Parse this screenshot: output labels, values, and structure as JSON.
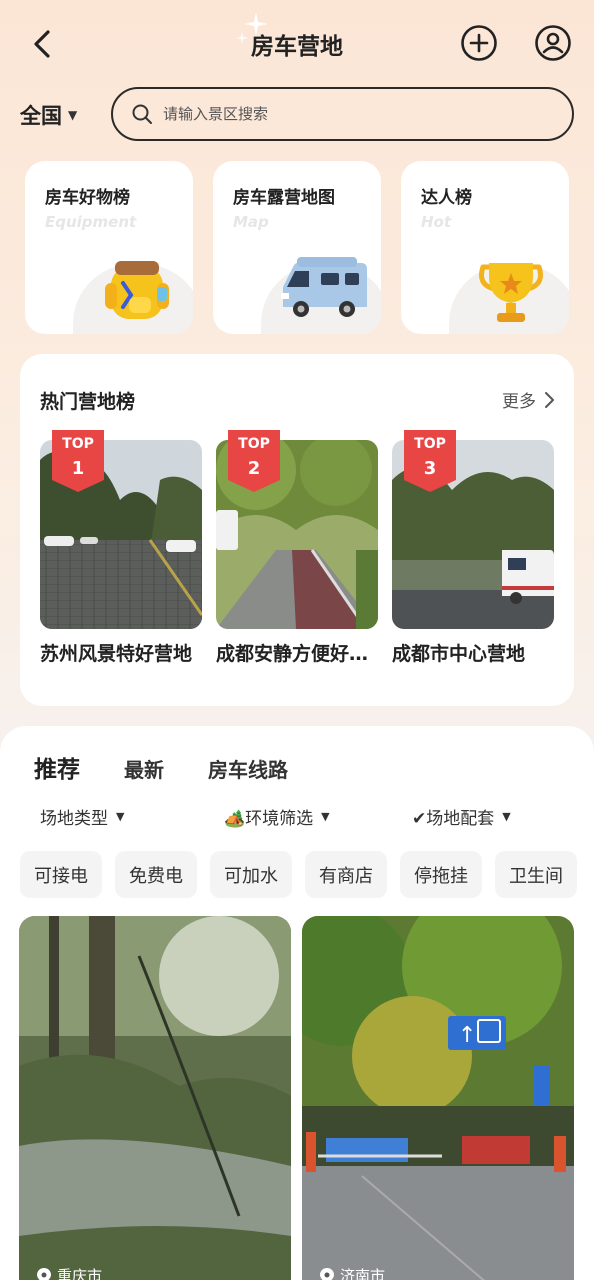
{
  "header": {
    "title": "房车营地",
    "back_icon": "chevron-left-icon",
    "add_icon": "plus-circle-icon",
    "user_icon": "user-circle-icon"
  },
  "location": {
    "value": "全国"
  },
  "search": {
    "placeholder": "请输入景区搜索"
  },
  "categories": [
    {
      "title": "房车好物榜",
      "subtitle": "Equipment",
      "icon": "backpack-icon"
    },
    {
      "title": "房车露营地图",
      "subtitle": "Map",
      "icon": "rv-icon"
    },
    {
      "title": "达人榜",
      "subtitle": "Hot",
      "icon": "trophy-icon"
    }
  ],
  "hot_camps": {
    "title": "热门营地榜",
    "more": "更多",
    "badge_label": "TOP",
    "items": [
      {
        "rank": "1",
        "name": "苏州风景特好营地"
      },
      {
        "rank": "2",
        "name": "成都安静方便好营地"
      },
      {
        "rank": "3",
        "name": "成都市中心营地"
      }
    ]
  },
  "recommend": {
    "tabs": [
      "推荐",
      "最新",
      "房车线路"
    ],
    "filters": [
      "场地类型",
      "🏕️环境筛选",
      "✔场地配套"
    ],
    "chips": [
      "可接电",
      "免费电",
      "可加水",
      "有商店",
      "停拖挂",
      "卫生间"
    ],
    "feed": [
      {
        "city": "重庆市"
      },
      {
        "city": "济南市"
      }
    ]
  },
  "colors": {
    "accent_red": "#e23b3b",
    "badge_red": "#e84545",
    "card_bg": "#ffffff"
  }
}
